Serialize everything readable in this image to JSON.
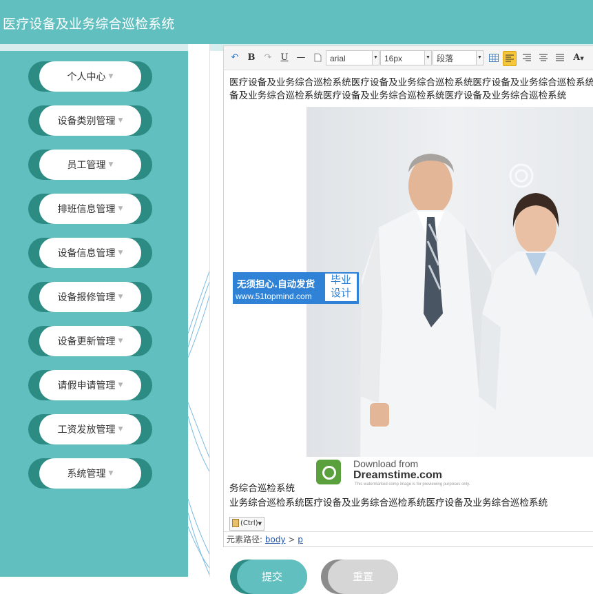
{
  "header": {
    "title": "医疗设备及业务综合巡检系统"
  },
  "sidebar": {
    "items": [
      {
        "label": "个人中心"
      },
      {
        "label": "设备类别管理"
      },
      {
        "label": "员工管理"
      },
      {
        "label": "排班信息管理"
      },
      {
        "label": "设备信息管理"
      },
      {
        "label": "设备报修管理"
      },
      {
        "label": "设备更新管理"
      },
      {
        "label": "请假申请管理"
      },
      {
        "label": "工资发放管理"
      },
      {
        "label": "系统管理"
      }
    ],
    "caret": "▼"
  },
  "editor": {
    "toolbar": {
      "undo": "↶",
      "bold": "B",
      "redo": "↷",
      "underline": "U",
      "hr": "—",
      "font_family": "arial",
      "font_size": "16px",
      "paragraph": "段落",
      "font_color": "A"
    },
    "content": {
      "line1": "医疗设备及业务综合巡检系统医疗设备及业务综合巡检系统医疗设备及业务综合巡检系统",
      "line2": "备及业务综合巡检系统医疗设备及业务综合巡检系统医疗设备及业务综合巡检系统",
      "line3": "务综合巡检系统",
      "line4": "业务综合巡检系统医疗设备及业务综合巡检系统医疗设备及业务综合巡检系统"
    },
    "image_badge": {
      "line1": "Download from",
      "line2": "Dreamstime.com",
      "line3": "This watermarked comp image is for previewing purposes only."
    },
    "paste_label": "(Ctrl)",
    "status": {
      "label": "元素路径:",
      "path1": "body",
      "sep": ">",
      "path2": "p"
    }
  },
  "watermark": {
    "line1": "无须担心.自动发货",
    "line2": "www.51topmind.com",
    "box_line1": "毕业",
    "box_line2": "设计"
  },
  "buttons": {
    "submit": "提交",
    "reset": "重置"
  },
  "colors": {
    "accent": "#61bfbf",
    "accent_dark": "#2c8b83",
    "watermark_blue": "#2f82d6"
  }
}
